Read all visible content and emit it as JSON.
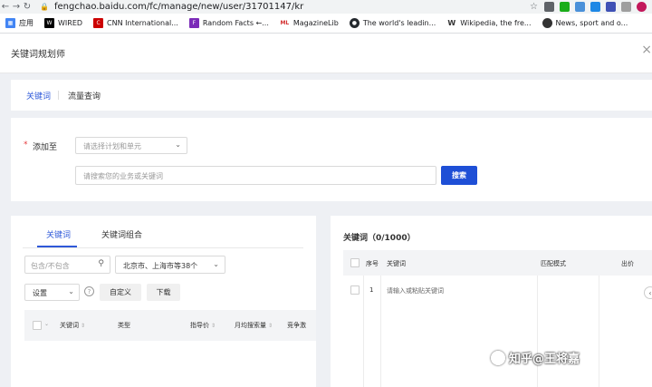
{
  "browser": {
    "url": "fengchao.baidu.com/fc/manage/new/user/31701147/kr",
    "bookmarks": [
      {
        "label": "应用",
        "icon": "apps-grid-icon",
        "color": "#4285f4"
      },
      {
        "label": "WIRED",
        "icon": "wired-favicon",
        "color": "#000000"
      },
      {
        "label": "CNN International...",
        "icon": "cnn-favicon",
        "color": "#cc0000"
      },
      {
        "label": "Random Facts ←...",
        "icon": "random-facts-favicon",
        "color": "#7b2ab8"
      },
      {
        "label": "MagazineLib",
        "icon": "magazinelib-favicon",
        "color": "#d32f2f"
      },
      {
        "label": "The world's leadin...",
        "icon": "github-favicon",
        "color": "#24292e"
      },
      {
        "label": "Wikipedia, the fre...",
        "icon": "wikipedia-favicon",
        "color": "#333333"
      },
      {
        "label": "News, sport and o...",
        "icon": "bbc-favicon",
        "color": "#333333"
      }
    ]
  },
  "app": {
    "title": "关键词规划师",
    "close": "×"
  },
  "tabs": {
    "active": "关键词",
    "second": "流量查询"
  },
  "form": {
    "required_mark": "*",
    "add_label": "添加至",
    "plan_placeholder": "请选择计划和单元",
    "search_placeholder": "请搜索您的业务或关键词",
    "search_button": "搜索"
  },
  "left": {
    "tab1": "关键词",
    "tab2": "关键词组合",
    "include_placeholder": "包含/不包含",
    "region": "北京市、上海市等38个",
    "settings": "设置",
    "help": "?",
    "custom_button": "自定义",
    "download_button": "下载",
    "columns": [
      "关键词",
      "类型",
      "指导价",
      "月均搜索量",
      "竞争激"
    ]
  },
  "right": {
    "title": "关键词（0/1000）",
    "columns": [
      "序号",
      "关键词",
      "匹配模式",
      "出价"
    ],
    "row": {
      "index": "1",
      "placeholder": "请输入或粘贴关键词"
    }
  },
  "watermark": "知乎@王将嘉",
  "colors": {
    "accent": "#2e59d9",
    "button": "#1e4fd6",
    "required": "#e4393c"
  }
}
